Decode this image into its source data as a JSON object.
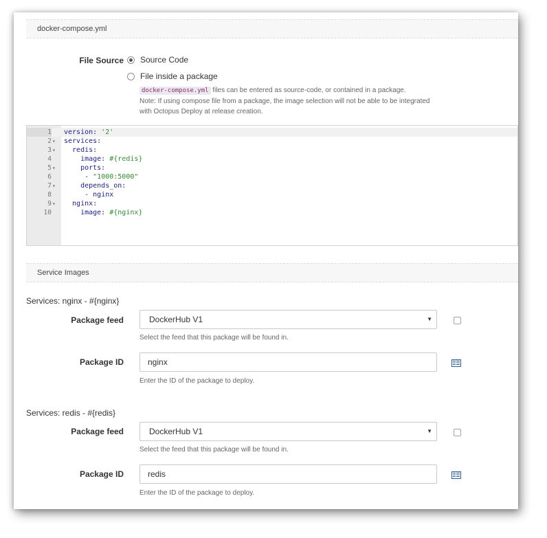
{
  "compose_section": {
    "title": "docker-compose.yml"
  },
  "file_source": {
    "label": "File Source",
    "option_source_code": "Source Code",
    "option_package": "File inside a package",
    "help_code": "docker-compose.yml",
    "help_line1_rest": " files can be entered as source-code, or contained in a package.",
    "help_line2": "Note: If using compose file from a package, the image selection will not be able to be integrated",
    "help_line3": "with Octopus Deploy at release creation."
  },
  "editor": {
    "lines": [
      {
        "num": "1",
        "fold": "",
        "parts": [
          [
            "k",
            "version: "
          ],
          [
            "s",
            "'2'"
          ]
        ]
      },
      {
        "num": "2",
        "fold": "▾",
        "parts": [
          [
            "k",
            "services:"
          ]
        ]
      },
      {
        "num": "3",
        "fold": "▾",
        "parts": [
          [
            "k",
            "  redis:"
          ]
        ]
      },
      {
        "num": "4",
        "fold": "",
        "parts": [
          [
            "k",
            "    image: "
          ],
          [
            "s",
            "#{redis}"
          ]
        ]
      },
      {
        "num": "5",
        "fold": "▾",
        "parts": [
          [
            "k",
            "    ports:"
          ]
        ]
      },
      {
        "num": "6",
        "fold": "",
        "parts": [
          [
            "d",
            "     - "
          ],
          [
            "s",
            "\"1000:5000\""
          ]
        ]
      },
      {
        "num": "7",
        "fold": "▾",
        "parts": [
          [
            "k",
            "    depends_on:"
          ]
        ]
      },
      {
        "num": "8",
        "fold": "",
        "parts": [
          [
            "d",
            "     - "
          ],
          [
            "k",
            "nginx"
          ]
        ]
      },
      {
        "num": "9",
        "fold": "▾",
        "parts": [
          [
            "k",
            "  nginx:"
          ]
        ]
      },
      {
        "num": "10",
        "fold": "",
        "parts": [
          [
            "k",
            "    image: "
          ],
          [
            "s",
            "#{nginx}"
          ]
        ]
      }
    ]
  },
  "service_images_section": {
    "title": "Service Images"
  },
  "services": {
    "nginx": {
      "title": "Services: nginx - #{nginx}",
      "feed_label": "Package feed",
      "feed_value": "DockerHub V1",
      "feed_help": "Select the feed that this package will be found in.",
      "id_label": "Package ID",
      "id_value": "nginx",
      "id_help": "Enter the ID of the package to deploy."
    },
    "redis": {
      "title": "Services: redis - #{redis}",
      "feed_label": "Package feed",
      "feed_value": "DockerHub V1",
      "feed_help": "Select the feed that this package will be found in.",
      "id_label": "Package ID",
      "id_value": "redis",
      "id_help": "Enter the ID of the package to deploy."
    }
  },
  "icons": {
    "select_arrow": "▼",
    "variable_picker": "variable-grid-icon"
  }
}
